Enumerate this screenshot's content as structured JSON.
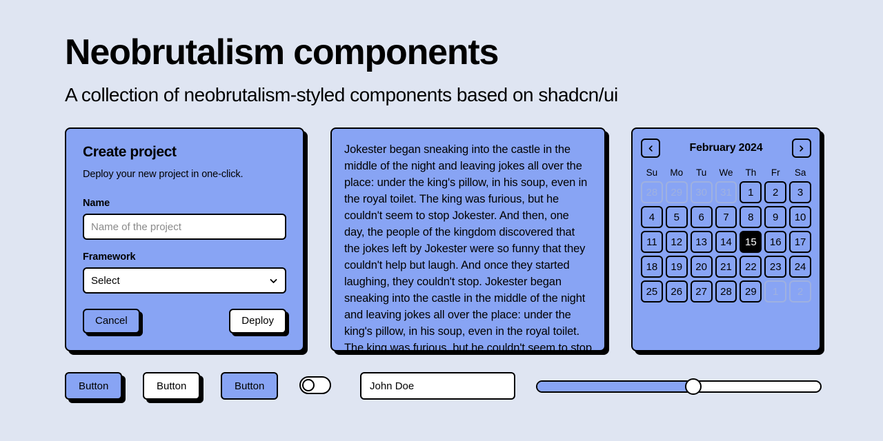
{
  "header": {
    "title": "Neobrutalism components",
    "subtitle": "A collection of neobrutalism-styled components based on shadcn/ui"
  },
  "theme": {
    "page_background": "#dfe5f2",
    "accent": "#88a4f4",
    "border": "#000000",
    "surface": "#ffffff",
    "muted_text": "#8a8a8a"
  },
  "create_card": {
    "title": "Create project",
    "description": "Deploy your new project in one-click.",
    "name_label": "Name",
    "name_value": "",
    "name_placeholder": "Name of the project",
    "framework_label": "Framework",
    "framework_selected": "Select",
    "framework_chevron": "chevron-down-icon",
    "cancel_label": "Cancel",
    "deploy_label": "Deploy"
  },
  "text_card": {
    "body": "Jokester began sneaking into the castle in the middle of the night and leaving jokes all over the place: under the king's pillow, in his soup, even in the royal toilet. The king was furious, but he couldn't seem to stop Jokester. And then, one day, the people of the kingdom discovered that the jokes left by Jokester were so funny that they couldn't help but laugh. And once they started laughing, they couldn't stop. Jokester began sneaking into the castle in the middle of the night and leaving jokes all over the place: under the king's pillow, in his soup, even in the royal toilet. The king was furious, but he couldn't seem to stop Jokester."
  },
  "calendar": {
    "prev_icon": "chevron-left-icon",
    "next_icon": "chevron-right-icon",
    "month_label": "February 2024",
    "weekdays": [
      "Su",
      "Mo",
      "Tu",
      "We",
      "Th",
      "Fr",
      "Sa"
    ],
    "selected_day": 15,
    "days": [
      {
        "n": "28",
        "outside": true
      },
      {
        "n": "29",
        "outside": true
      },
      {
        "n": "30",
        "outside": true
      },
      {
        "n": "31",
        "outside": true
      },
      {
        "n": "1",
        "outside": false
      },
      {
        "n": "2",
        "outside": false
      },
      {
        "n": "3",
        "outside": false
      },
      {
        "n": "4",
        "outside": false
      },
      {
        "n": "5",
        "outside": false
      },
      {
        "n": "6",
        "outside": false
      },
      {
        "n": "7",
        "outside": false
      },
      {
        "n": "8",
        "outside": false
      },
      {
        "n": "9",
        "outside": false
      },
      {
        "n": "10",
        "outside": false
      },
      {
        "n": "11",
        "outside": false
      },
      {
        "n": "12",
        "outside": false
      },
      {
        "n": "13",
        "outside": false
      },
      {
        "n": "14",
        "outside": false
      },
      {
        "n": "15",
        "outside": false,
        "selected": true
      },
      {
        "n": "16",
        "outside": false
      },
      {
        "n": "17",
        "outside": false
      },
      {
        "n": "18",
        "outside": false
      },
      {
        "n": "19",
        "outside": false
      },
      {
        "n": "20",
        "outside": false
      },
      {
        "n": "21",
        "outside": false
      },
      {
        "n": "22",
        "outside": false
      },
      {
        "n": "23",
        "outside": false
      },
      {
        "n": "24",
        "outside": false
      },
      {
        "n": "25",
        "outside": false
      },
      {
        "n": "26",
        "outside": false
      },
      {
        "n": "27",
        "outside": false
      },
      {
        "n": "28",
        "outside": false
      },
      {
        "n": "29",
        "outside": false
      },
      {
        "n": "1",
        "outside": true
      },
      {
        "n": "2",
        "outside": true
      }
    ]
  },
  "showcase": {
    "button_default": "Button",
    "button_neutral": "Button",
    "button_noshadow": "Button",
    "switch_checked": false,
    "input_value": "John Doe",
    "input_placeholder": "John Doe",
    "slider_value": 55,
    "slider_min": 0,
    "slider_max": 100
  }
}
